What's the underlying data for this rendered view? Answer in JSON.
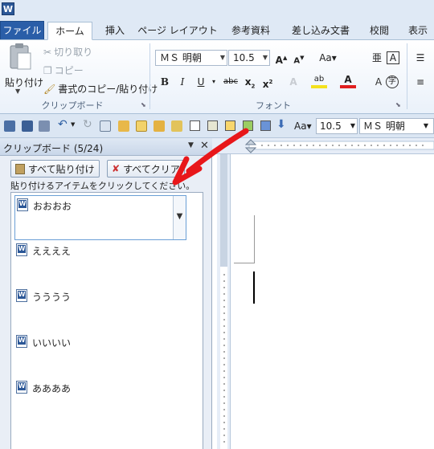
{
  "app": {
    "logo_letter": "W"
  },
  "tabs": [
    "ファイル",
    "ホーム",
    "挿入",
    "ページ レイアウト",
    "参考資料",
    "差し込み文書",
    "校閲",
    "表示"
  ],
  "ribbon": {
    "clipboard": {
      "paste_label": "貼り付け",
      "cut_label": "切り取り",
      "copy_label": "コピー",
      "format_painter_label": "書式のコピー/貼り付け",
      "group_label": "クリップボード"
    },
    "font": {
      "font_name": "ＭＳ 明朝",
      "font_size": "10.5",
      "group_label": "フォント",
      "case_label": "Aa"
    }
  },
  "qat": {
    "font_size": "10.5",
    "font_name": "ＭＳ 明朝",
    "case_label": "Aa"
  },
  "clipboard_pane": {
    "title": "クリップボード (5/24)",
    "paste_all_label": "すべて貼り付け",
    "clear_all_label": "すべてクリア",
    "instructions": "貼り付けるアイテムをクリックしてください。",
    "items": [
      "おおおお",
      "ええええ",
      "うううう",
      "いいいい",
      "ああああ"
    ]
  }
}
